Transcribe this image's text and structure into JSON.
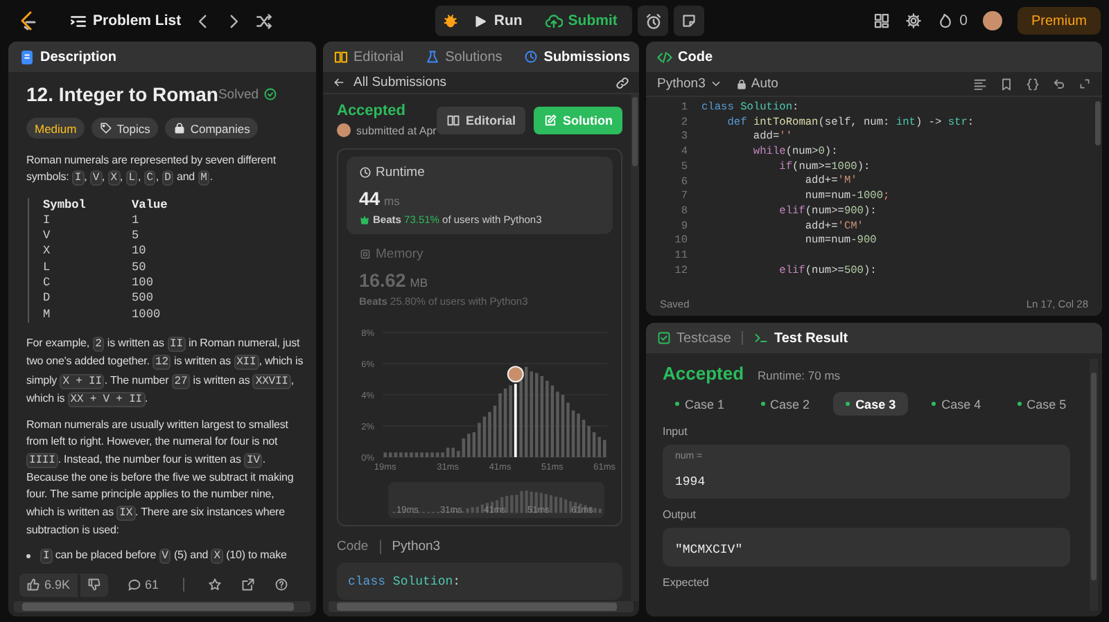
{
  "topbar": {
    "problem_list": "Problem List",
    "run": "Run",
    "submit": "Submit",
    "streak": "0",
    "premium": "Premium"
  },
  "description": {
    "tab": "Description",
    "title": "12. Integer to Roman",
    "status": "Solved",
    "tags": [
      {
        "kind": "difficulty",
        "label": "Medium"
      },
      {
        "kind": "topics",
        "label": "Topics"
      },
      {
        "kind": "companies",
        "label": "Companies"
      }
    ],
    "intro": [
      {
        "kind": "text",
        "text": "Roman numerals are represented by seven different symbols: "
      },
      {
        "kind": "code",
        "text": "I"
      },
      {
        "kind": "text",
        "text": ", "
      },
      {
        "kind": "code",
        "text": "V"
      },
      {
        "kind": "text",
        "text": ", "
      },
      {
        "kind": "code",
        "text": "X"
      },
      {
        "kind": "text",
        "text": ", "
      },
      {
        "kind": "code",
        "text": "L"
      },
      {
        "kind": "text",
        "text": ", "
      },
      {
        "kind": "code",
        "text": "C"
      },
      {
        "kind": "text",
        "text": ", "
      },
      {
        "kind": "code",
        "text": "D"
      },
      {
        "kind": "text",
        "text": " and "
      },
      {
        "kind": "code",
        "text": "M"
      },
      {
        "kind": "text",
        "text": "."
      }
    ],
    "table": {
      "columns": [
        "Symbol",
        "Value"
      ],
      "rows": [
        [
          "I",
          "1"
        ],
        [
          "V",
          "5"
        ],
        [
          "X",
          "10"
        ],
        [
          "L",
          "50"
        ],
        [
          "C",
          "100"
        ],
        [
          "D",
          "500"
        ],
        [
          "M",
          "1000"
        ]
      ]
    },
    "paragraphs": [
      [
        {
          "kind": "text",
          "text": "For example, "
        },
        {
          "kind": "code",
          "text": "2"
        },
        {
          "kind": "text",
          "text": " is written as "
        },
        {
          "kind": "code",
          "text": "II"
        },
        {
          "kind": "text",
          "text": " in Roman numeral, just two one's added together. "
        },
        {
          "kind": "code",
          "text": "12"
        },
        {
          "kind": "text",
          "text": " is written as "
        },
        {
          "kind": "code",
          "text": "XII"
        },
        {
          "kind": "text",
          "text": ", which is simply "
        },
        {
          "kind": "code",
          "text": "X + II"
        },
        {
          "kind": "text",
          "text": ". The number "
        },
        {
          "kind": "code",
          "text": "27"
        },
        {
          "kind": "text",
          "text": " is written as "
        },
        {
          "kind": "code",
          "text": "XXVII"
        },
        {
          "kind": "text",
          "text": ", which is "
        },
        {
          "kind": "code",
          "text": "XX + V + II"
        },
        {
          "kind": "text",
          "text": "."
        }
      ],
      [
        {
          "kind": "text",
          "text": "Roman numerals are usually written largest to smallest from left to right. However, the numeral for four is not "
        },
        {
          "kind": "code",
          "text": "IIII"
        },
        {
          "kind": "text",
          "text": ". Instead, the number four is written as "
        },
        {
          "kind": "code",
          "text": "IV"
        },
        {
          "kind": "text",
          "text": ". Because the one is before the five we subtract it making four. The same principle applies to the number nine, which is written as "
        },
        {
          "kind": "code",
          "text": "IX"
        },
        {
          "kind": "text",
          "text": ". There are six instances where subtraction is used:"
        }
      ]
    ],
    "bullets": [
      [
        {
          "kind": "code",
          "text": "I"
        },
        {
          "kind": "text",
          "text": " can be placed before "
        },
        {
          "kind": "code",
          "text": "V"
        },
        {
          "kind": "text",
          "text": " (5) and "
        },
        {
          "kind": "code",
          "text": "X"
        },
        {
          "kind": "text",
          "text": " (10) to make"
        }
      ]
    ],
    "footer": {
      "likes": "6.9K",
      "comments": "61"
    }
  },
  "submission": {
    "tabs": [
      {
        "label": "Editorial",
        "selected": false
      },
      {
        "label": "Solutions",
        "selected": false
      },
      {
        "label": "Submissions",
        "selected": true
      }
    ],
    "back": "All Submissions",
    "status": "Accepted",
    "submitted": "submitted at Apr",
    "buttons": [
      {
        "kind": "editorial",
        "label": "Editorial"
      },
      {
        "kind": "solution",
        "label": "Solution"
      }
    ],
    "metrics": [
      {
        "kind": "runtime",
        "label": "Runtime",
        "value": "44",
        "unit": "ms",
        "beats": "Beats",
        "percent": "73.51%",
        "suffix": "of users with Python3",
        "selected": true
      },
      {
        "kind": "memory",
        "label": "Memory",
        "value": "16.62",
        "unit": "MB",
        "beats": "Beats",
        "percent": "25.80%",
        "suffix": "of users with Python3",
        "selected": false
      }
    ],
    "chart_data": {
      "type": "bar",
      "x": [
        19,
        20,
        21,
        22,
        23,
        24,
        25,
        26,
        27,
        28,
        29,
        30,
        31,
        32,
        33,
        34,
        35,
        36,
        37,
        38,
        39,
        40,
        41,
        42,
        43,
        44,
        45,
        46,
        47,
        48,
        49,
        50,
        51,
        52,
        53,
        54,
        55,
        56,
        57,
        58,
        59,
        60,
        61
      ],
      "series": [
        {
          "color": "#5a5a5a",
          "values": [
            0.3,
            0.3,
            0.3,
            0.3,
            0.3,
            0.3,
            0.3,
            0.3,
            0.3,
            0.3,
            0.3,
            0.3,
            0.6,
            0.6,
            0.4,
            1.2,
            1.5,
            1.6,
            2.2,
            2.6,
            2.9,
            3.3,
            4.1,
            4.4,
            4.6,
            null,
            5.7,
            5.8,
            5.5,
            5.4,
            5.2,
            4.9,
            4.6,
            4.2,
            4.0,
            3.5,
            3.0,
            2.8,
            2.4,
            2.0,
            1.6,
            1.3,
            1.1
          ]
        },
        {
          "color": "#ffffff",
          "values": [
            null,
            null,
            null,
            null,
            null,
            null,
            null,
            null,
            null,
            null,
            null,
            null,
            null,
            null,
            null,
            null,
            null,
            null,
            null,
            null,
            null,
            null,
            null,
            null,
            null,
            4.7,
            null,
            null,
            null,
            null,
            null,
            null,
            null,
            null,
            null,
            null,
            null,
            null,
            null,
            null,
            null,
            null,
            null
          ]
        }
      ],
      "stacked": true,
      "grid": true,
      "xlim": [
        19,
        61
      ],
      "ylim": [
        0,
        8
      ],
      "xticks": [
        {
          "value": 19,
          "label": "19ms"
        },
        {
          "value": 31,
          "label": "31ms"
        },
        {
          "value": 41,
          "label": "41ms"
        },
        {
          "value": 51,
          "label": "51ms"
        },
        {
          "value": 61,
          "label": "61ms"
        }
      ],
      "yticks": [
        {
          "value": 0,
          "label": "0%"
        },
        {
          "value": 2,
          "label": "2%"
        },
        {
          "value": 4,
          "label": "4%"
        },
        {
          "value": 6,
          "label": "6%"
        },
        {
          "value": 8,
          "label": "8%"
        }
      ]
    },
    "overview_labels": [
      "19ms",
      "31ms",
      "41ms",
      "51ms",
      "61ms"
    ],
    "code_label": "Code",
    "code_lang": "Python3",
    "code_preview": [
      {
        "kind": "kw",
        "text": "class"
      },
      {
        "kind": "cls",
        "text": " Solution"
      },
      {
        "kind": "p",
        "text": ":"
      }
    ]
  },
  "code": {
    "tab": "Code",
    "language": "Python3",
    "mode": "Auto",
    "status": "Saved",
    "position": "Ln 17, Col 28",
    "lines": [
      {
        "n": "1",
        "tokens": [
          {
            "kind": "kw",
            "text": "class"
          },
          {
            "kind": "cls",
            "text": " Solution"
          },
          {
            "kind": "p",
            "text": ":"
          }
        ]
      },
      {
        "n": "2",
        "tokens": [
          {
            "kind": "kw",
            "text": "    def"
          },
          {
            "kind": "fn",
            "text": " intToRoman"
          },
          {
            "kind": "p",
            "text": "(self, num: "
          },
          {
            "kind": "cls",
            "text": "int"
          },
          {
            "kind": "p",
            "text": ") -> "
          },
          {
            "kind": "cls",
            "text": "str"
          },
          {
            "kind": "p",
            "text": ":"
          }
        ]
      },
      {
        "n": "3",
        "tokens": [
          {
            "kind": "p",
            "text": "        add="
          },
          {
            "kind": "str",
            "text": "''"
          }
        ]
      },
      {
        "n": "4",
        "tokens": [
          {
            "kind": "ctl",
            "text": "        while"
          },
          {
            "kind": "p",
            "text": "(num>"
          },
          {
            "kind": "num",
            "text": "0"
          },
          {
            "kind": "p",
            "text": "):"
          }
        ]
      },
      {
        "n": "5",
        "tokens": [
          {
            "kind": "ctl",
            "text": "            if"
          },
          {
            "kind": "p",
            "text": "(num>="
          },
          {
            "kind": "num",
            "text": "1000"
          },
          {
            "kind": "p",
            "text": "):"
          }
        ]
      },
      {
        "n": "6",
        "tokens": [
          {
            "kind": "p",
            "text": "                add+="
          },
          {
            "kind": "str",
            "text": "'M'"
          }
        ]
      },
      {
        "n": "7",
        "tokens": [
          {
            "kind": "p",
            "text": "                num=num-"
          },
          {
            "kind": "num",
            "text": "1000"
          },
          {
            "kind": "err",
            "text": ";"
          }
        ]
      },
      {
        "n": "8",
        "tokens": [
          {
            "kind": "ctl",
            "text": "            elif"
          },
          {
            "kind": "p",
            "text": "(num>="
          },
          {
            "kind": "num",
            "text": "900"
          },
          {
            "kind": "p",
            "text": "):"
          }
        ]
      },
      {
        "n": "9",
        "tokens": [
          {
            "kind": "p",
            "text": "                add+="
          },
          {
            "kind": "str",
            "text": "'CM'"
          }
        ]
      },
      {
        "n": "10",
        "tokens": [
          {
            "kind": "p",
            "text": "                num=num-"
          },
          {
            "kind": "num",
            "text": "900"
          }
        ]
      },
      {
        "n": "11"
      },
      {
        "n": "12",
        "tokens": [
          {
            "kind": "ctl",
            "text": "            elif"
          },
          {
            "kind": "p",
            "text": "(num>="
          },
          {
            "kind": "num",
            "text": "500"
          },
          {
            "kind": "p",
            "text": "):"
          }
        ]
      }
    ]
  },
  "result": {
    "tabs": [
      {
        "label": "Testcase",
        "selected": false
      },
      {
        "label": "Test Result",
        "selected": true
      }
    ],
    "status": "Accepted",
    "runtime": "Runtime: 70 ms",
    "cases": [
      {
        "label": "Case 1",
        "selected": false
      },
      {
        "label": "Case 2",
        "selected": false
      },
      {
        "label": "Case 3",
        "selected": true
      },
      {
        "label": "Case 4",
        "selected": false
      },
      {
        "label": "Case 5",
        "selected": false
      }
    ],
    "sections": [
      {
        "label": "Input",
        "name": "num =",
        "value": "1994"
      },
      {
        "label": "Output",
        "value": "\"MCMXCIV\""
      }
    ],
    "expected_label": "Expected"
  }
}
